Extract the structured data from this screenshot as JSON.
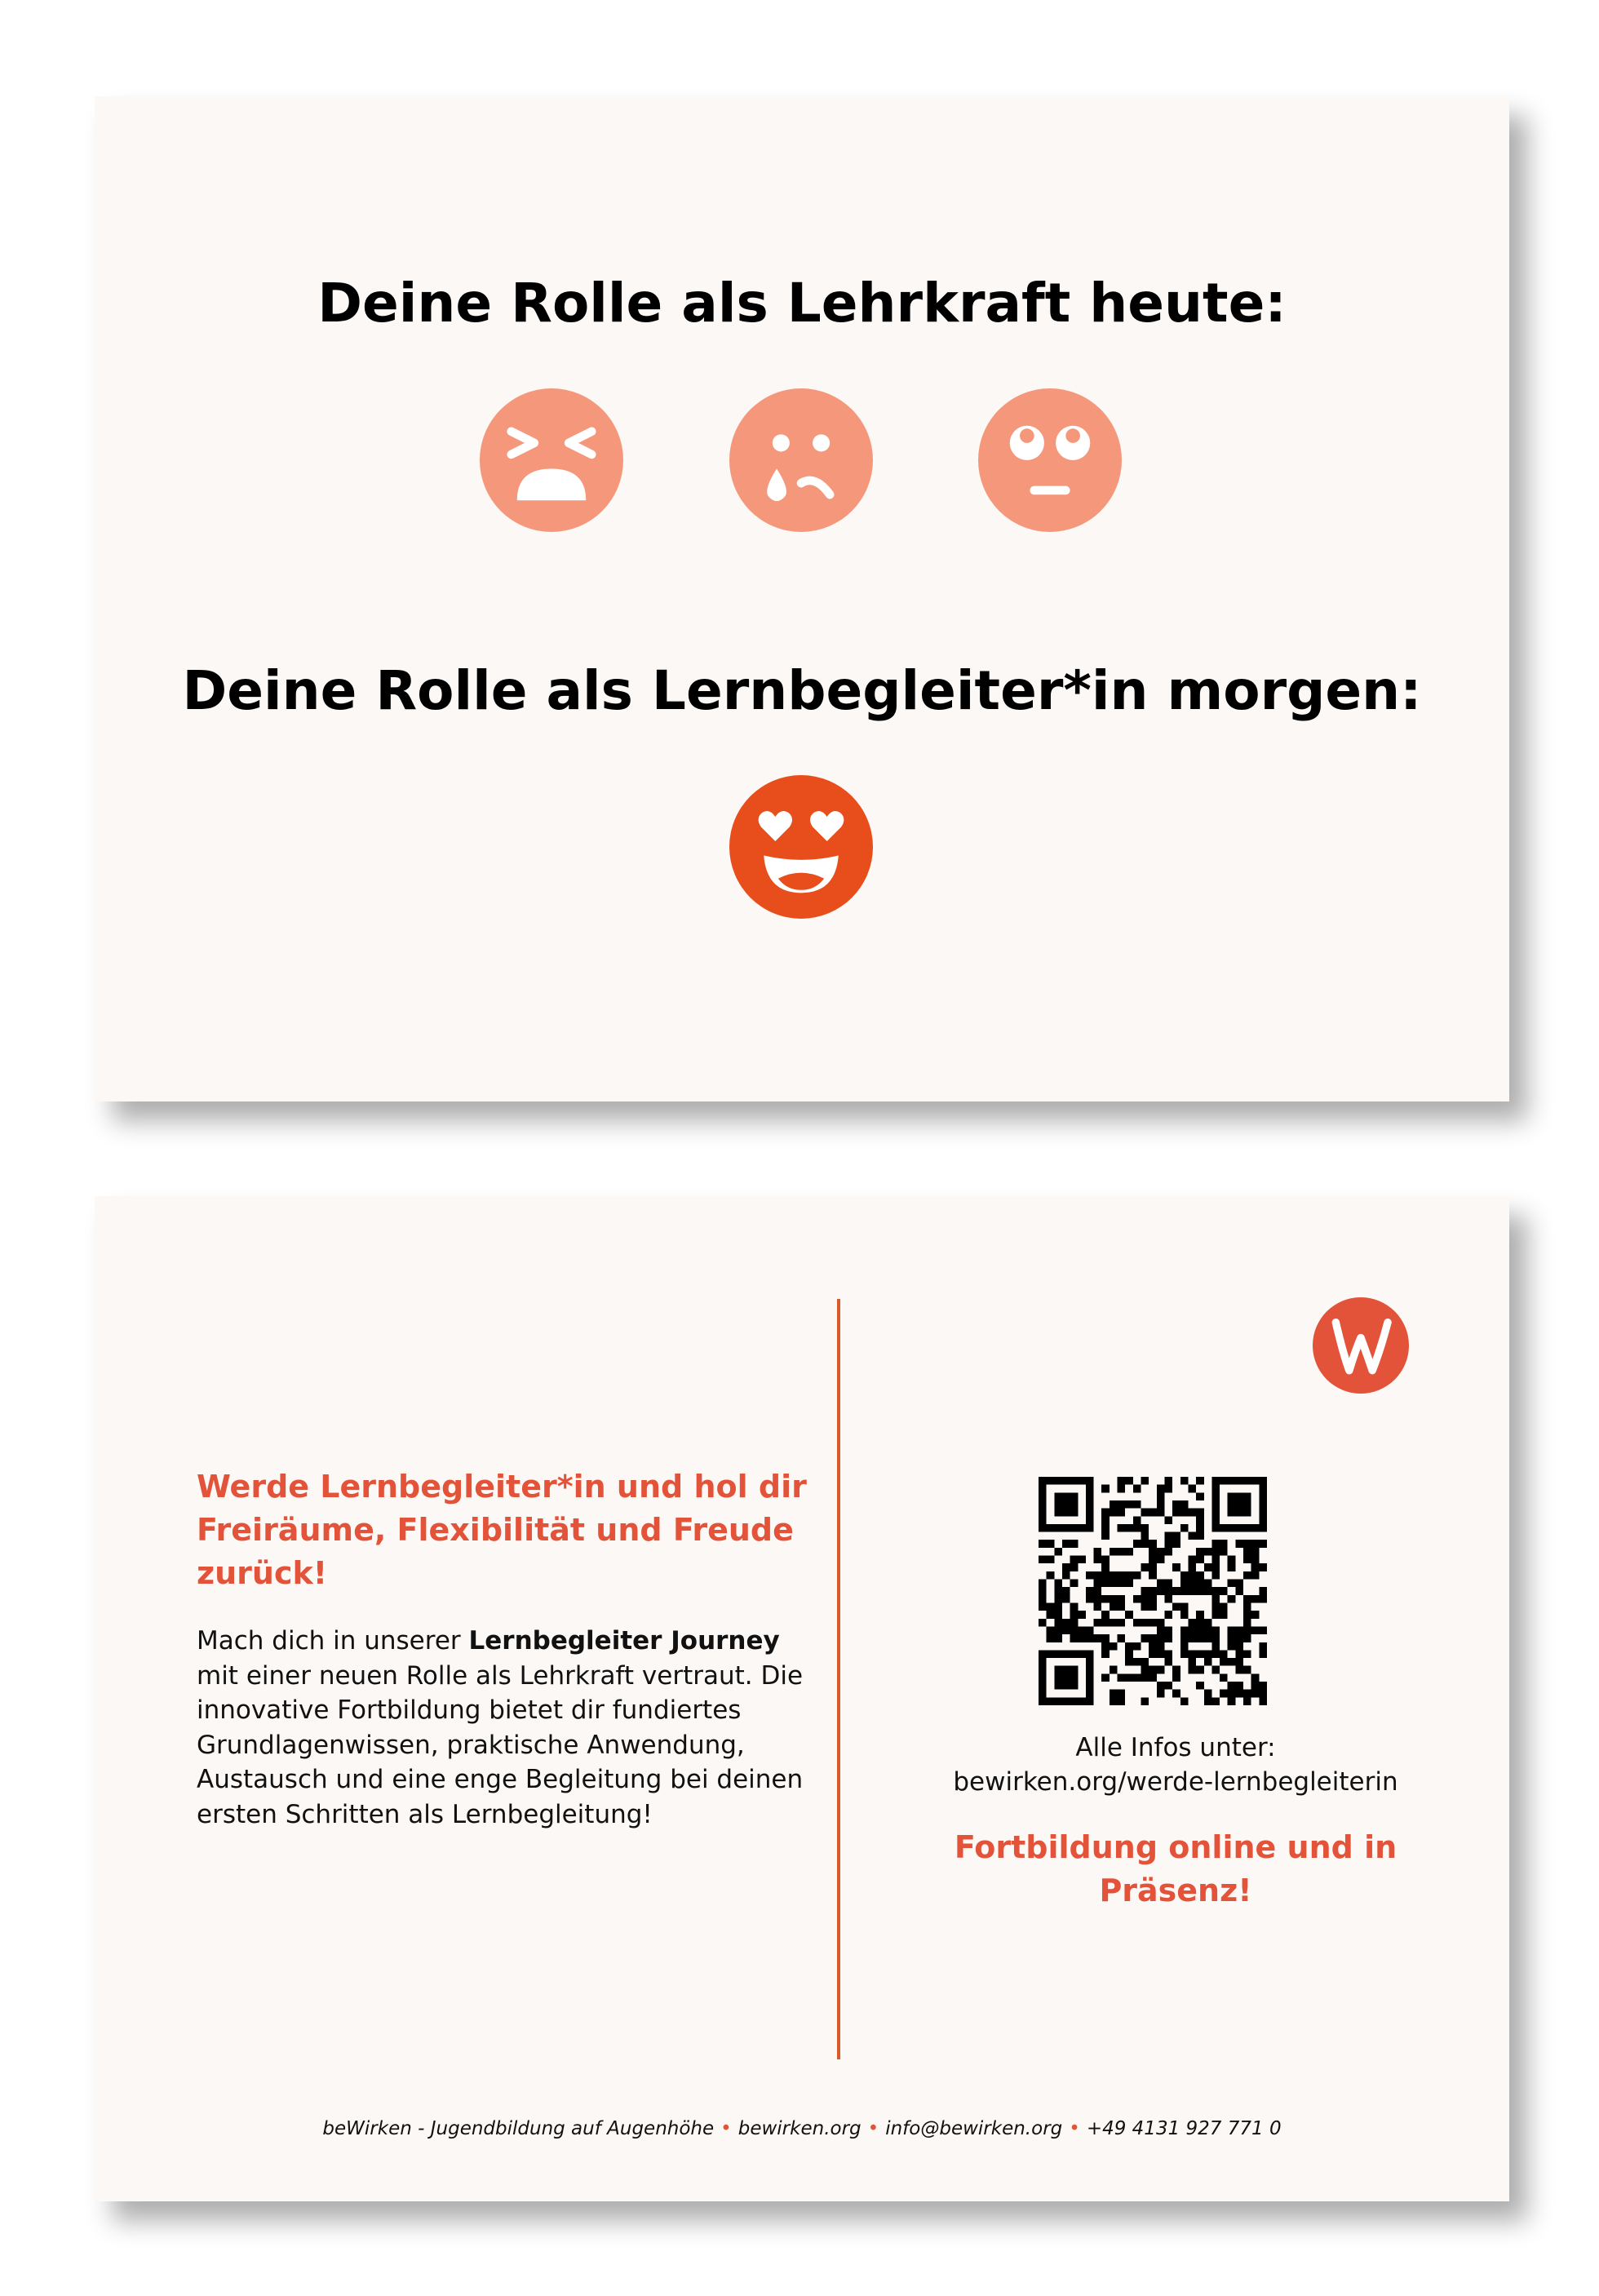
{
  "front": {
    "heading_today": "Deine Rolle als Lehrkraft heute:",
    "heading_tomorrow": "Deine Rolle als Lernbegleiter*in morgen:",
    "emojis_today": [
      "tired-face-icon",
      "crying-face-icon",
      "eye-roll-face-icon"
    ],
    "emoji_tomorrow": "heart-eyes-face-icon",
    "colors": {
      "emoji_today": "#f4977a",
      "emoji_tomorrow": "#e84e1b",
      "card": "#fcf8f5"
    }
  },
  "back": {
    "headline": "Werde Lernbegleiter*in und hol dir Freiräume, Flexibilität und Freude zurück!",
    "body_prefix": "Mach dich in unserer ",
    "body_bold": "Lernbegleiter Journey",
    "body_suffix": " mit einer neuen Rolle als Lehrkraft vertraut. Die innovative Fortbildung bietet dir fundiertes Grundlagenwissen, praktische Anwendung, Austausch und eine enge Begleitung bei deinen ersten Schritten als Lernbegleitung!",
    "info_label": "Alle Infos unter:",
    "info_url": "bewirken.org/werde-lernbegleiterin",
    "cta": "Fortbildung online und in Präsenz!",
    "logo": "bewirken-w-logo",
    "footer": {
      "org": "beWirken - Jugendbildung auf Augenhöhe",
      "web": "bewirken.org",
      "email": "info@bewirken.org",
      "phone": "+49 4131 927 771 0",
      "separator": "•"
    },
    "colors": {
      "accent": "#e2533a",
      "divider": "#d85a2b"
    }
  }
}
